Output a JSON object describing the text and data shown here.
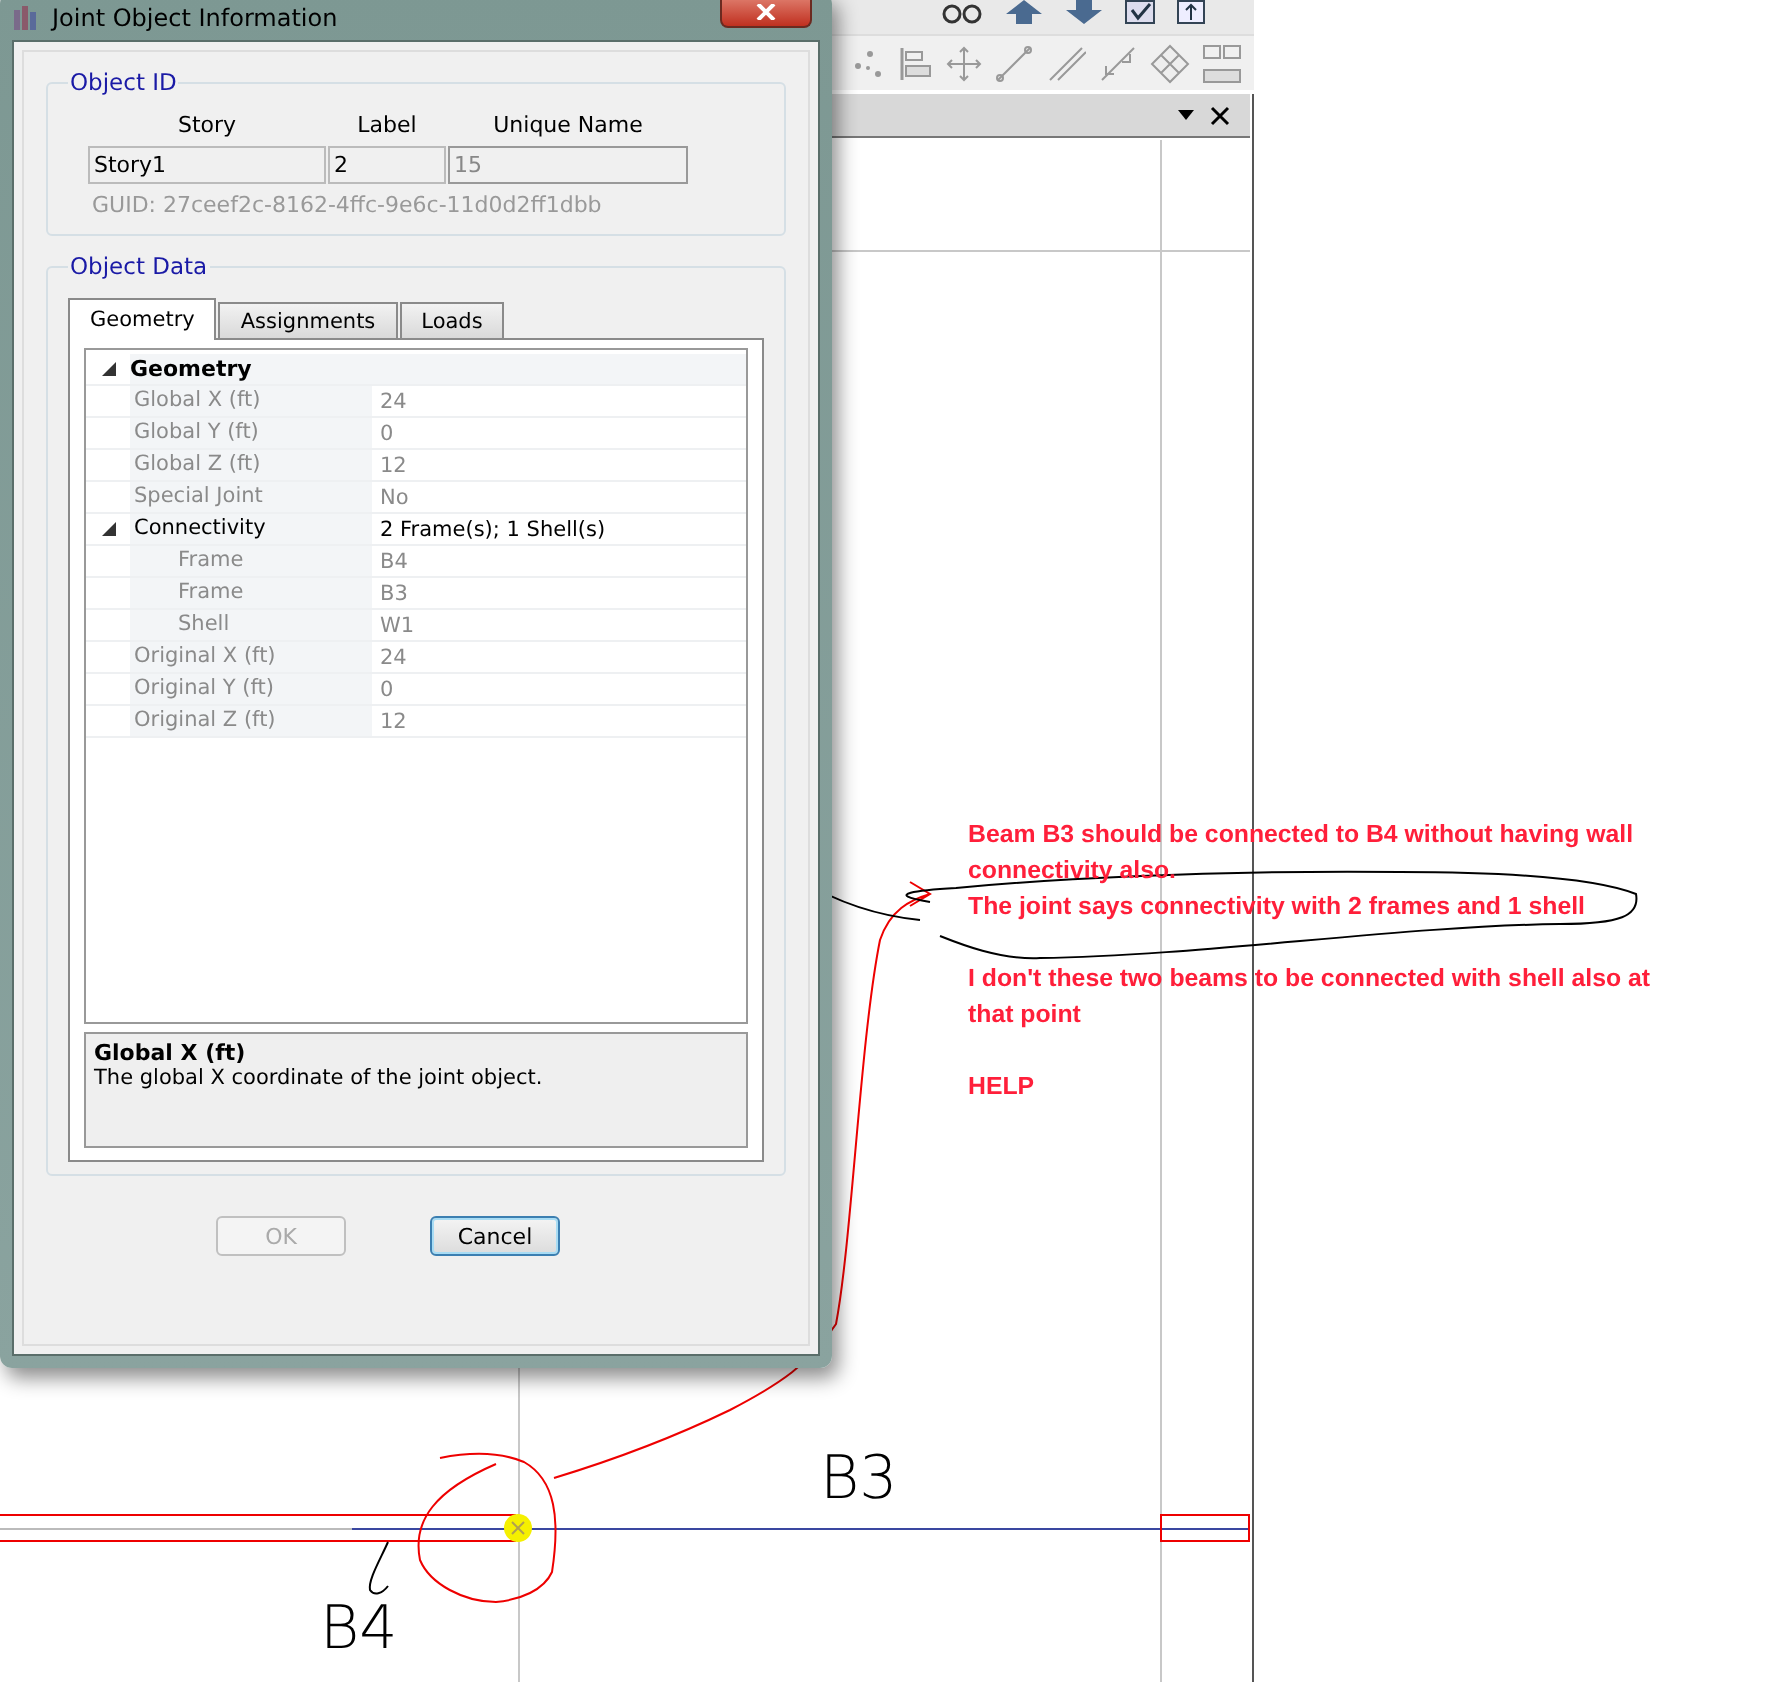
{
  "dialog": {
    "title": "Joint Object Information",
    "object_id": {
      "group_title": "Object ID",
      "columns": [
        "Story",
        "Label",
        "Unique Name"
      ],
      "fields": [
        {
          "value": "Story1",
          "disabled": false
        },
        {
          "value": "2",
          "disabled": false
        },
        {
          "value": "15",
          "disabled": true
        }
      ],
      "guid": "GUID:  27ceef2c-8162-4ffc-9e6c-11d0d2ff1dbb"
    },
    "object_data": {
      "group_title": "Object Data",
      "tabs": [
        {
          "label": "Geometry",
          "selected": true
        },
        {
          "label": "Assignments",
          "selected": false
        },
        {
          "label": "Loads",
          "selected": false
        }
      ],
      "properties": [
        {
          "label": "Geometry",
          "expanded": true,
          "children": [
            {
              "label": "Global X (ft)",
              "value": "24",
              "disabled": true
            },
            {
              "label": "Global Y (ft)",
              "value": "0",
              "disabled": true
            },
            {
              "label": "Global Z (ft)",
              "value": "12",
              "disabled": true
            },
            {
              "label": "Special Joint",
              "value": "No",
              "disabled": true
            },
            {
              "label": "Connectivity",
              "value": "2 Frame(s); 1 Shell(s)",
              "disabled": false,
              "expanded": true,
              "children": [
                {
                  "label": "Frame",
                  "value": "B4",
                  "disabled": true
                },
                {
                  "label": "Frame",
                  "value": "B3",
                  "disabled": true
                },
                {
                  "label": "Shell",
                  "value": "W1",
                  "disabled": true
                }
              ]
            },
            {
              "label": "Original X (ft)",
              "value": "24",
              "disabled": true
            },
            {
              "label": "Original Y (ft)",
              "value": "0",
              "disabled": true
            },
            {
              "label": "Original Z (ft)",
              "value": "12",
              "disabled": true
            }
          ]
        }
      ],
      "description": {
        "title": "Global X (ft)",
        "text": "The global X coordinate of the joint object."
      }
    },
    "buttons": [
      {
        "label": "OK",
        "disabled": true,
        "focused": false
      },
      {
        "label": "Cancel",
        "disabled": false,
        "focused": true
      }
    ]
  },
  "annotation": {
    "blocks": [
      {
        "lines": [
          "Beam B3 should be connected to B4 without having wall connectivity also.",
          "The joint says connectivity with 2 frames and 1 shell"
        ]
      },
      {
        "lines": [
          "I don't these two beams to be connected with shell also at that point"
        ]
      },
      {
        "lines": [
          "HELP"
        ]
      }
    ]
  },
  "beam_labels": [
    {
      "text": "B3"
    },
    {
      "text": "B4"
    }
  ]
}
